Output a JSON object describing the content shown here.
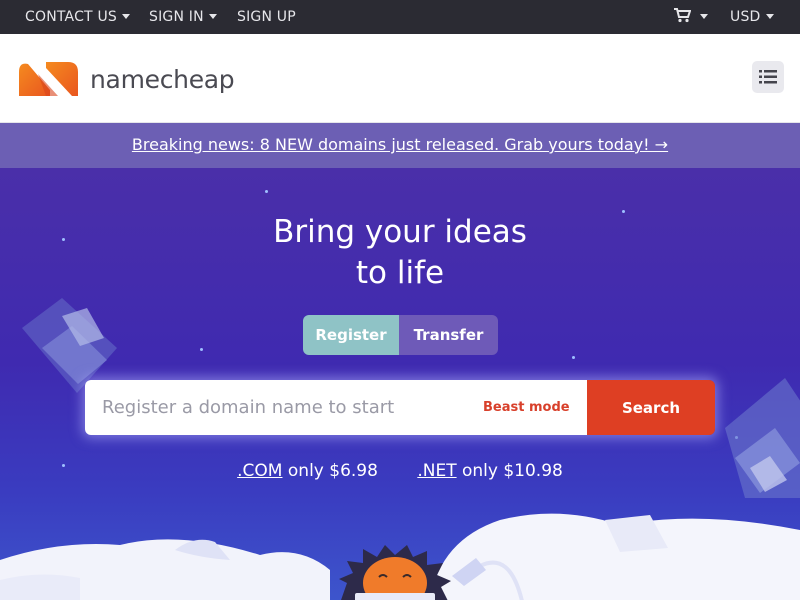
{
  "topbar": {
    "contact": "CONTACT US",
    "signin": "SIGN IN",
    "signup": "SIGN UP",
    "currency": "USD"
  },
  "header": {
    "logo_text": "namecheap",
    "menu_icon": "list-menu-icon"
  },
  "newsbar": {
    "text": "Breaking news: 8 NEW domains just released. Grab yours today! →"
  },
  "hero": {
    "title_line1": "Bring your ideas",
    "title_line2": "to life",
    "tabs": [
      {
        "label": "Register",
        "active": true
      },
      {
        "label": "Transfer",
        "active": false
      }
    ],
    "search": {
      "placeholder": "Register a domain name to start",
      "beast_mode": "Beast mode",
      "button": "Search"
    },
    "prices": [
      {
        "tld": ".COM",
        "text": "only $6.98"
      },
      {
        "tld": ".NET",
        "text": "only $10.98"
      }
    ]
  },
  "colors": {
    "topbar": "#2b2b33",
    "newsbar": "#6c5fb4",
    "hero": "#4a2fa9",
    "accent": "#de3f23",
    "register_tab": "#8fc3c6",
    "logo_orange": "#f26a21"
  }
}
